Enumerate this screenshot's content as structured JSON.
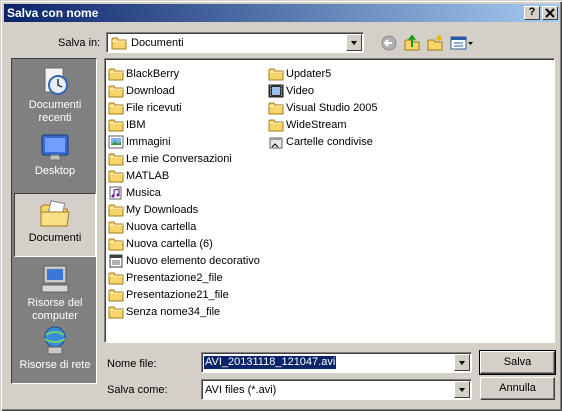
{
  "window": {
    "title": "Salva con nome",
    "help_label": "?",
    "close_label": "x"
  },
  "location": {
    "label": "Salva in:",
    "value": "Documenti"
  },
  "toolbar": {
    "back_icon": "back-arrow-icon",
    "up_icon": "up-folder-icon",
    "new_folder_icon": "new-folder-icon",
    "views_icon": "views-menu-icon"
  },
  "places": [
    {
      "label": "Documenti recenti",
      "icon": "recent-documents-icon"
    },
    {
      "label": "Desktop",
      "icon": "desktop-icon"
    },
    {
      "label": "Documenti",
      "icon": "documents-folder-icon"
    },
    {
      "label": "Risorse del computer",
      "icon": "my-computer-icon"
    },
    {
      "label": "Risorse di rete",
      "icon": "network-icon"
    }
  ],
  "files": {
    "column1": [
      {
        "name": "BlackBerry",
        "icon": "folder"
      },
      {
        "name": "Download",
        "icon": "folder"
      },
      {
        "name": "File ricevuti",
        "icon": "folder"
      },
      {
        "name": "IBM",
        "icon": "folder"
      },
      {
        "name": "Immagini",
        "icon": "pictures-folder"
      },
      {
        "name": "Le mie Conversazioni",
        "icon": "folder"
      },
      {
        "name": "MATLAB",
        "icon": "folder"
      },
      {
        "name": "Musica",
        "icon": "music-folder"
      },
      {
        "name": "My Downloads",
        "icon": "folder"
      },
      {
        "name": "Nuova cartella",
        "icon": "folder"
      },
      {
        "name": "Nuova cartella (6)",
        "icon": "folder"
      },
      {
        "name": "Nuovo elemento decorativo",
        "icon": "file"
      },
      {
        "name": "Presentazione2_file",
        "icon": "folder"
      },
      {
        "name": "Presentazione21_file",
        "icon": "folder"
      },
      {
        "name": "Senza nome34_file",
        "icon": "folder"
      }
    ],
    "column2": [
      {
        "name": "Updater5",
        "icon": "folder"
      },
      {
        "name": "Video",
        "icon": "video-folder"
      },
      {
        "name": "Visual Studio 2005",
        "icon": "folder"
      },
      {
        "name": "WideStream",
        "icon": "folder"
      },
      {
        "name": "Cartelle condivise",
        "icon": "shared-folder"
      }
    ]
  },
  "filename": {
    "label": "Nome file:",
    "value": "AVI_20131118_121047.avi"
  },
  "filetype": {
    "label": "Salva come:",
    "value": "AVI files (*.avi)"
  },
  "buttons": {
    "save": "Salva",
    "cancel": "Annulla"
  },
  "colors": {
    "title_start": "#0a246a",
    "title_end": "#a6caf0",
    "face": "#d4d0c8",
    "selection": "#0a246a"
  }
}
